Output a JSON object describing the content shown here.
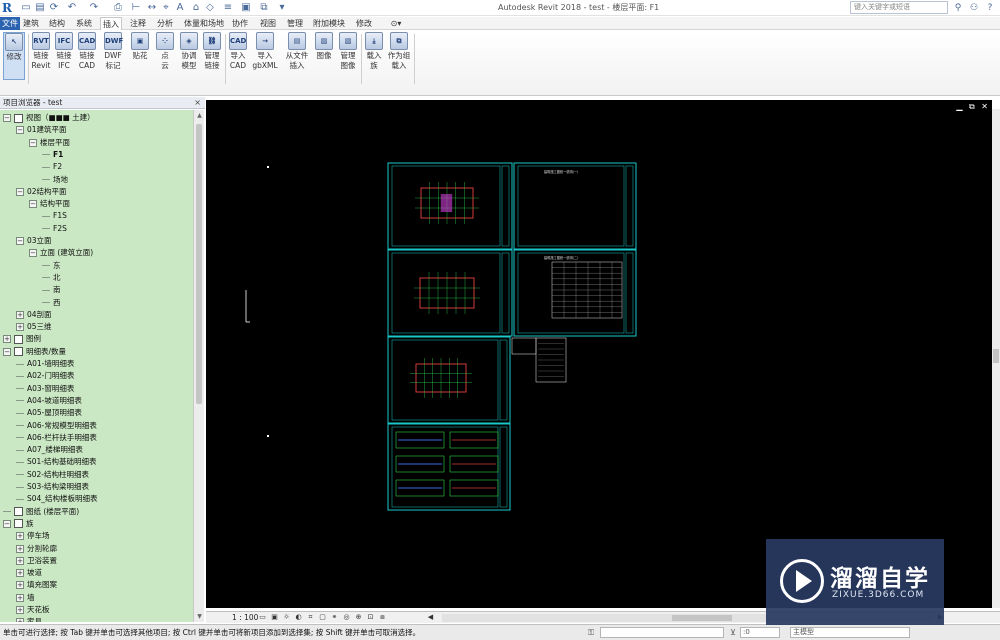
{
  "app": {
    "title": "Autodesk Revit 2018 -    test - 楼层平面: F1",
    "search_placeholder": "键入关键字或短语",
    "logo": "R"
  },
  "tabs": [
    "文件",
    "建筑",
    "结构",
    "系统",
    "插入",
    "注释",
    "分析",
    "体量和场地",
    "协作",
    "视图",
    "管理",
    "附加模块",
    "修改"
  ],
  "active_tab": "插入",
  "ribbon": {
    "buttons": [
      {
        "label": "修改",
        "icon": "cursor-icon",
        "glyph": "↖"
      },
      {
        "label": "链接\nRevit",
        "icon": "link-revit-icon",
        "glyph": "RVT"
      },
      {
        "label": "链接\nIFC",
        "icon": "link-ifc-icon",
        "glyph": "IFC"
      },
      {
        "label": "链接\nCAD",
        "icon": "link-cad-icon",
        "glyph": "CAD"
      },
      {
        "label": "DWF\n标记",
        "icon": "dwf-markup-icon",
        "glyph": "DWF"
      },
      {
        "label": "贴花",
        "icon": "decal-icon",
        "glyph": "▣"
      },
      {
        "label": "点\n云",
        "icon": "point-cloud-icon",
        "glyph": "⁘"
      },
      {
        "label": "协调\n模型",
        "icon": "coordination-model-icon",
        "glyph": "◈"
      },
      {
        "label": "管理\n链接",
        "icon": "manage-links-icon",
        "glyph": "⛓"
      },
      {
        "label": "导入\nCAD",
        "icon": "import-cad-icon",
        "glyph": "CAD"
      },
      {
        "label": "导入\ngbXML",
        "icon": "import-gbxml-icon",
        "glyph": "→"
      },
      {
        "label": "从文件\n插入",
        "icon": "insert-from-file-icon",
        "glyph": "▤"
      },
      {
        "label": "图像",
        "icon": "image-icon",
        "glyph": "▨"
      },
      {
        "label": "管理\n图像",
        "icon": "manage-images-icon",
        "glyph": "▧"
      },
      {
        "label": "载入\n族",
        "icon": "load-family-icon",
        "glyph": "⤓"
      },
      {
        "label": "作为组\n载入",
        "icon": "load-as-group-icon",
        "glyph": "⧉"
      }
    ]
  },
  "project_browser": {
    "title": "项目浏览器 - test",
    "close": "×",
    "rows": [
      {
        "text": "视图（■■■ 土建）",
        "level": 0,
        "toggle": "-",
        "kind": "view"
      },
      {
        "text": "01建筑平面",
        "level": 1,
        "toggle": "-"
      },
      {
        "text": "楼层平面",
        "level": 2,
        "toggle": "-"
      },
      {
        "text": "F1",
        "level": 3,
        "toggle": "",
        "bold": true
      },
      {
        "text": "F2",
        "level": 3,
        "toggle": ""
      },
      {
        "text": "场地",
        "level": 3,
        "toggle": ""
      },
      {
        "text": "02结构平面",
        "level": 1,
        "toggle": "-"
      },
      {
        "text": "结构平面",
        "level": 2,
        "toggle": "-"
      },
      {
        "text": "F1S",
        "level": 3,
        "toggle": ""
      },
      {
        "text": "F2S",
        "level": 3,
        "toggle": ""
      },
      {
        "text": "03立面",
        "level": 1,
        "toggle": "-"
      },
      {
        "text": "立面 (建筑立面)",
        "level": 2,
        "toggle": "-"
      },
      {
        "text": "东",
        "level": 3,
        "toggle": ""
      },
      {
        "text": "北",
        "level": 3,
        "toggle": ""
      },
      {
        "text": "南",
        "level": 3,
        "toggle": ""
      },
      {
        "text": "西",
        "level": 3,
        "toggle": ""
      },
      {
        "text": "04剖面",
        "level": 1,
        "toggle": "+"
      },
      {
        "text": "05三维",
        "level": 1,
        "toggle": "+"
      },
      {
        "text": "图例",
        "level": 0,
        "toggle": "+",
        "kind": "box"
      },
      {
        "text": "明细表/数量",
        "level": 0,
        "toggle": "-",
        "kind": "box"
      },
      {
        "text": "A01-墙明细表",
        "level": 1,
        "toggle": ""
      },
      {
        "text": "A02-门明细表",
        "level": 1,
        "toggle": ""
      },
      {
        "text": "A03-窗明细表",
        "level": 1,
        "toggle": ""
      },
      {
        "text": "A04-坡道明细表",
        "level": 1,
        "toggle": ""
      },
      {
        "text": "A05-屋顶明细表",
        "level": 1,
        "toggle": ""
      },
      {
        "text": "A06-常规模型明细表",
        "level": 1,
        "toggle": ""
      },
      {
        "text": "A06-栏杆扶手明细表",
        "level": 1,
        "toggle": ""
      },
      {
        "text": "A07_楼梯明细表",
        "level": 1,
        "toggle": ""
      },
      {
        "text": "S01-结构基础明细表",
        "level": 1,
        "toggle": ""
      },
      {
        "text": "S02-结构柱明细表",
        "level": 1,
        "toggle": ""
      },
      {
        "text": "S03-结构梁明细表",
        "level": 1,
        "toggle": ""
      },
      {
        "text": "S04_结构楼板明细表",
        "level": 1,
        "toggle": ""
      },
      {
        "text": "图纸 (楼层平面)",
        "level": 0,
        "toggle": "",
        "kind": "box"
      },
      {
        "text": "族",
        "level": 0,
        "toggle": "-",
        "kind": "box"
      },
      {
        "text": "停车场",
        "level": 1,
        "toggle": "+"
      },
      {
        "text": "分割轮廓",
        "level": 1,
        "toggle": "+"
      },
      {
        "text": "卫浴装置",
        "level": 1,
        "toggle": "+"
      },
      {
        "text": "坡道",
        "level": 1,
        "toggle": "+"
      },
      {
        "text": "填充图案",
        "level": 1,
        "toggle": "+"
      },
      {
        "text": "墙",
        "level": 1,
        "toggle": "+"
      },
      {
        "text": "天花板",
        "level": 1,
        "toggle": "+"
      },
      {
        "text": "家具",
        "level": 1,
        "toggle": "+"
      }
    ]
  },
  "canvas": {
    "window_controls": "▁ ⧉ ✕",
    "sheet_titles": [
      "建筑施工图统一说明(一)",
      "建筑施工图统一说明(二)"
    ]
  },
  "view_bar": {
    "scale": "1 : 100"
  },
  "status_bar": {
    "message": "单击可进行选择; 按 Tab 键并单击可选择其他项目; 按 Ctrl 键并单击可将新项目添加到选择集; 按 Shift 键并单击可取消选择。",
    "count": ":0",
    "model": "主模型"
  },
  "watermark": {
    "name": "溜溜自学",
    "url": "ZIXUE.3D66.COM"
  },
  "colors": {
    "browser_bg": "#cbe8c4",
    "canvas_bg": "#000000",
    "sheet_border": "#19c9c9",
    "file_tab": "#2b63b0",
    "watermark_bg": "#293a61"
  }
}
